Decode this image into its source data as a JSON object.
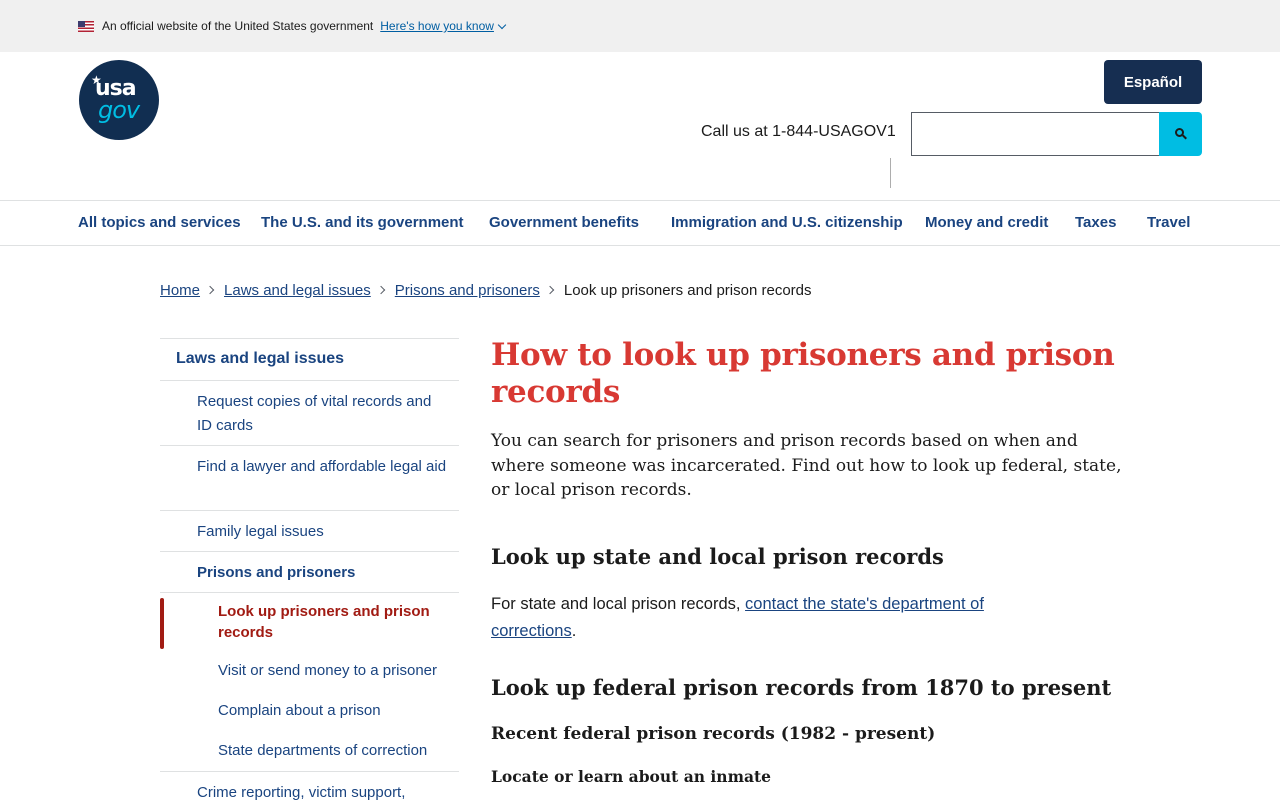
{
  "gov_banner": {
    "text": "An official website of the United States government",
    "link": "Here's how you know"
  },
  "header": {
    "logo_top": "usa",
    "logo_bottom": "gov",
    "language_button": "Español",
    "phone": "Call us at 1-844-USAGOV1",
    "search_placeholder": ""
  },
  "main_nav": [
    "All topics and services",
    "The U.S. and its government",
    "Government benefits",
    "Immigration and U.S. citizenship",
    "Money and credit",
    "Taxes",
    "Travel"
  ],
  "breadcrumb": {
    "links": [
      "Home",
      "Laws and legal issues",
      "Prisons and prisoners"
    ],
    "current": "Look up prisoners and prison records"
  },
  "sidenav": {
    "section": "Laws and legal issues",
    "items": [
      "Request copies of vital records and ID cards",
      "Find a lawyer and affordable legal aid",
      "Family legal issues"
    ],
    "parent": "Prisons and prisoners",
    "children": [
      "Look up prisoners and prison records",
      "Visit or send money to a prisoner",
      "Complain about a prison",
      "State departments of correction"
    ],
    "next_item": "Crime reporting, victim support,"
  },
  "content": {
    "title": "How to look up prisoners and prison records",
    "lede": "You can search for prisoners and prison records based on when and where someone was incarcerated. Find out how to look up federal, state, or local prison records.",
    "h2_state": "Look up state and local prison records",
    "state_text": "For state and local prison records,",
    "state_link": "contact the state's department of corrections",
    "state_end": ".",
    "h2_federal": "Look up federal prison records from 1870 to present",
    "h3_recent": "Recent federal prison records (1982 - present)",
    "h4_locate": "Locate or learn about an inmate"
  },
  "colors": {
    "primary_dark": "#162e51",
    "link": "#1a4480",
    "accent_cyan": "#00bde3",
    "title_red": "#d83933",
    "active_red": "#a11b13"
  }
}
